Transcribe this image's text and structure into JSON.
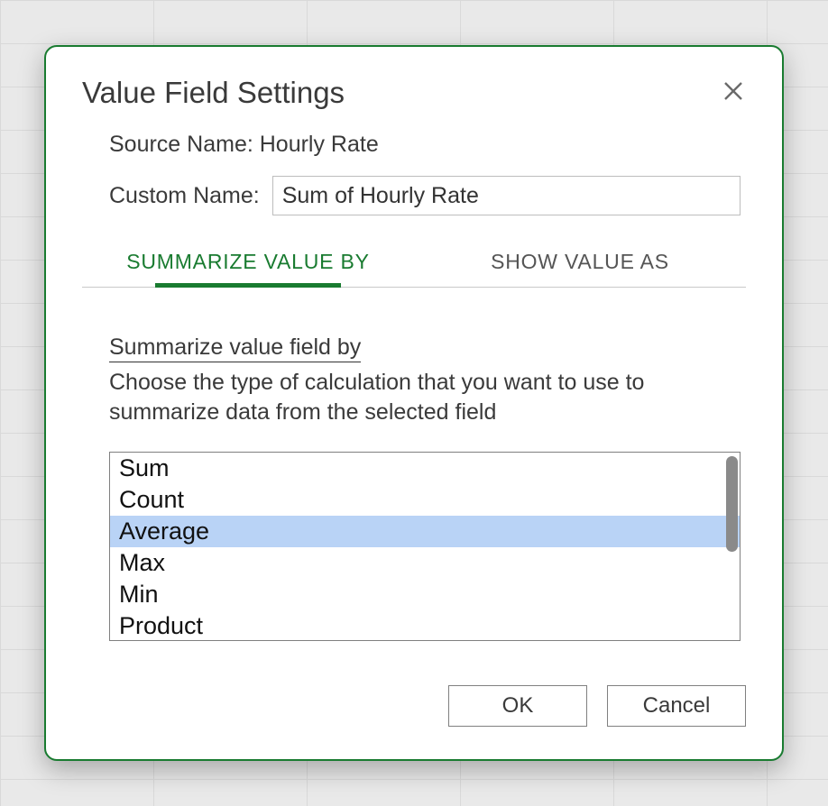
{
  "dialog": {
    "title": "Value Field Settings",
    "source_name_label": "Source Name:",
    "source_name_value": "Hourly Rate",
    "custom_name_label": "Custom Name:",
    "custom_name_value": "Sum of Hourly Rate",
    "tabs": [
      {
        "label": "SUMMARIZE VALUE BY",
        "active": true
      },
      {
        "label": "SHOW VALUE AS",
        "active": false
      }
    ],
    "section": {
      "title": "Summarize value field by",
      "description": "Choose the type of calculation that you want to use to summarize data from the selected field"
    },
    "list": {
      "options": [
        "Sum",
        "Count",
        "Average",
        "Max",
        "Min",
        "Product"
      ],
      "selected_index": 2
    },
    "buttons": {
      "ok": "OK",
      "cancel": "Cancel"
    }
  },
  "colors": {
    "accent": "#197b30",
    "selection": "#b9d3f6"
  }
}
